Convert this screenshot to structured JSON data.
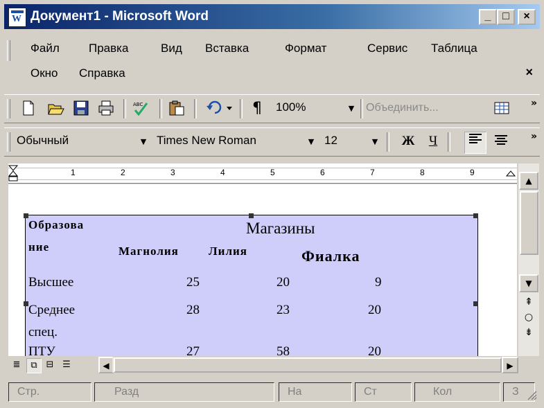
{
  "window": {
    "title": "Документ1 - Microsoft Word",
    "minimize": "_",
    "maximize": "□",
    "close": "×"
  },
  "menu": {
    "items": [
      "Файл",
      "Правка",
      "Вид",
      "Вставка",
      "Формат",
      "Сервис",
      "Таблица",
      "Окно",
      "Справка"
    ],
    "close_doc": "×"
  },
  "standard_toolbar": {
    "icons": [
      "new-document-icon",
      "open-folder-icon",
      "save-icon",
      "print-icon",
      "spelling-icon",
      "paste-icon",
      "undo-icon",
      "paragraph-marks-icon",
      "tables-icon"
    ],
    "paragraph": "¶",
    "zoom": "100%",
    "merge_cells": "Объединить...",
    "more": "»"
  },
  "format_toolbar": {
    "style": "Обычный",
    "font": "Times New Roman",
    "size": "12",
    "bold": "Ж",
    "underline": "Ч",
    "more": "»"
  },
  "ruler": {
    "numbers": [
      "1",
      "2",
      "3",
      "4",
      "5",
      "6",
      "7",
      "8",
      "9"
    ]
  },
  "table": {
    "header_col1": [
      "Образова",
      "ние"
    ],
    "group_header": "Магазины",
    "columns": [
      "Магнолия",
      "Лилия",
      "Фиалка"
    ],
    "rows": [
      {
        "label": "Высшее",
        "values": [
          "25",
          "20",
          "9"
        ]
      },
      {
        "label": "Среднее",
        "label2": "спец.",
        "values": [
          "28",
          "23",
          "20"
        ]
      },
      {
        "label": "ПТУ",
        "values": [
          "27",
          "58",
          "20"
        ]
      }
    ]
  },
  "status_bar": {
    "page": "Стр.",
    "section": "Разд",
    "at": "На",
    "line": "Ст",
    "column": "Кол",
    "extra": "З"
  },
  "colors": {
    "title_gradient_start": "#0a246a",
    "title_gradient_end": "#a6caf0",
    "table_shading": "#cfcdfa",
    "chrome": "#d4d0c8"
  }
}
